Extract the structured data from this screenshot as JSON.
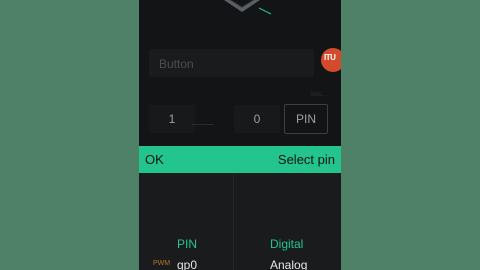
{
  "button_field": {
    "placeholder": "Button"
  },
  "badge": {
    "text": "ITU",
    "color": "#d44a2c"
  },
  "tiny_label": "Sets...",
  "range": {
    "from": "1",
    "to": "0"
  },
  "pin_button": "PIN",
  "action_bar": {
    "ok": "OK",
    "title": "Select pin",
    "color": "#23c48e"
  },
  "picker": {
    "pin_column": {
      "header": "PIN",
      "tag": "PWM",
      "item": "gp0"
    },
    "type_column": {
      "header": "Digital",
      "item": "Analog"
    }
  }
}
